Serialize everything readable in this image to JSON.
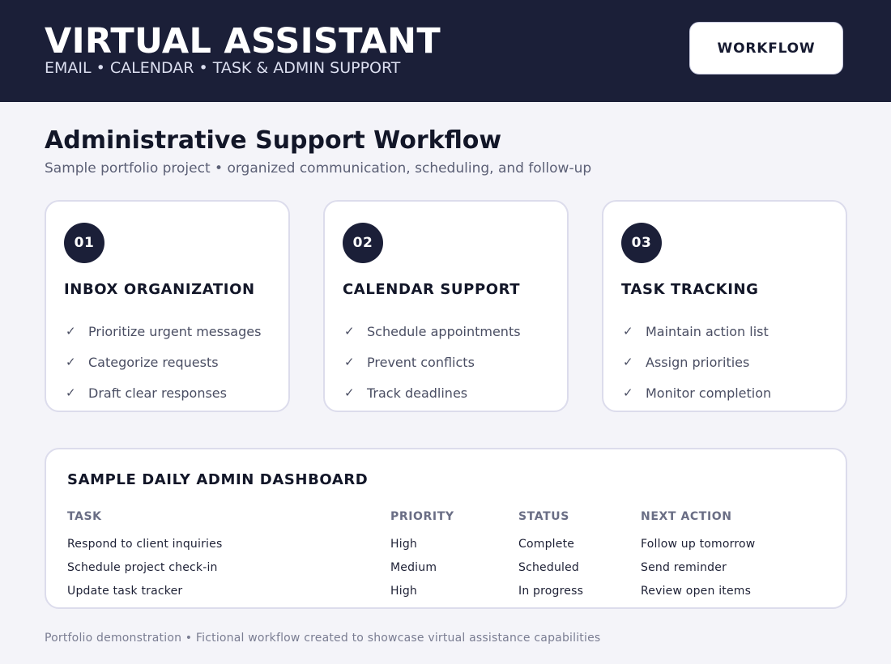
{
  "header": {
    "title": "VIRTUAL ASSISTANT",
    "subtitle": "EMAIL • CALENDAR • TASK & ADMIN SUPPORT",
    "workflow_button": "WORKFLOW"
  },
  "page": {
    "title": "Administrative Support Workflow",
    "subtitle": "Sample portfolio project • organized communication, scheduling, and follow-up"
  },
  "cards": [
    {
      "number": "01",
      "title": "INBOX ORGANIZATION",
      "items": [
        "Prioritize urgent messages",
        "Categorize requests",
        "Draft clear responses"
      ]
    },
    {
      "number": "02",
      "title": "CALENDAR SUPPORT",
      "items": [
        "Schedule appointments",
        "Prevent conflicts",
        "Track deadlines"
      ]
    },
    {
      "number": "03",
      "title": "TASK TRACKING",
      "items": [
        "Maintain action list",
        "Assign priorities",
        "Monitor completion"
      ]
    }
  ],
  "check_glyph": "✓",
  "dashboard": {
    "title": "SAMPLE DAILY ADMIN DASHBOARD",
    "columns": [
      "TASK",
      "PRIORITY",
      "STATUS",
      "NEXT ACTION"
    ],
    "rows": [
      [
        "Respond to client inquiries",
        "High",
        "Complete",
        "Follow up tomorrow"
      ],
      [
        "Schedule project check-in",
        "Medium",
        "Scheduled",
        "Send reminder"
      ],
      [
        "Update task tracker",
        "High",
        "In progress",
        "Review open items"
      ]
    ]
  },
  "footer": "Portfolio demonstration • Fictional workflow created to showcase virtual assistance capabilities",
  "colors": {
    "header_bg": "#1b1f38",
    "page_bg": "#f4f4f9",
    "accent": "#1b1f38"
  }
}
